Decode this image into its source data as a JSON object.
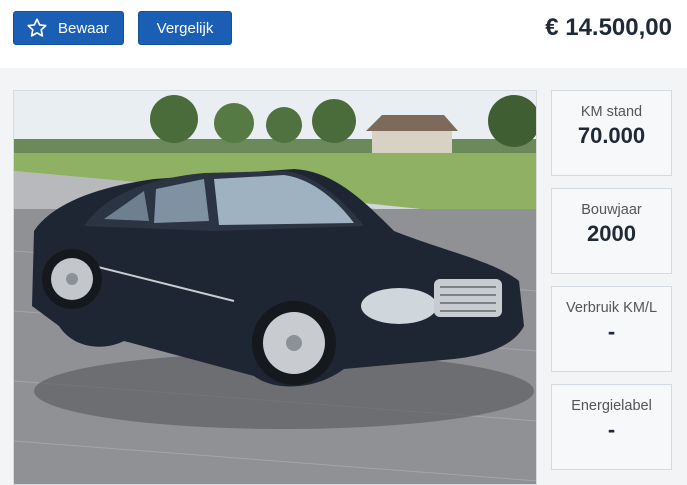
{
  "toolbar": {
    "save_label": "Bewaar",
    "compare_label": "Vergelijk",
    "save_icon": "star-icon"
  },
  "listing": {
    "price": "€ 14.500,00"
  },
  "photo": {
    "subject": "car-photo"
  },
  "specs": [
    {
      "label": "KM stand",
      "value": "70.000"
    },
    {
      "label": "Bouwjaar",
      "value": "2000"
    },
    {
      "label": "Verbruik KM/L",
      "value": "-"
    },
    {
      "label": "Energielabel",
      "value": "-"
    }
  ],
  "colors": {
    "button": "#1a5fb4",
    "price_text": "#1f2937",
    "spec_bg": "#f6f8fa",
    "spec_border": "#d3dae2"
  }
}
